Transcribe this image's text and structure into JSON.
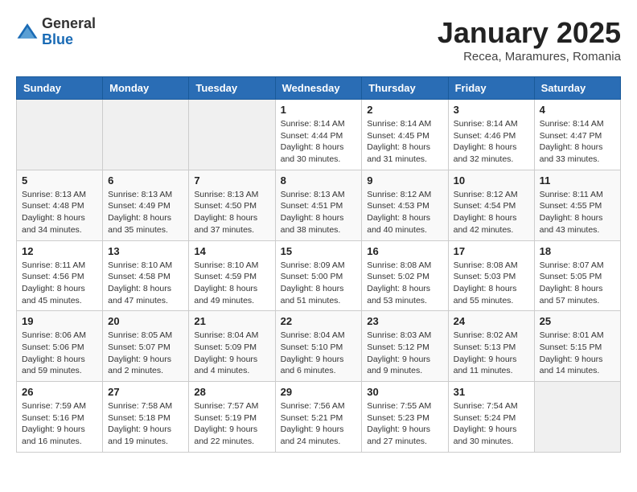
{
  "logo": {
    "general": "General",
    "blue": "Blue"
  },
  "header": {
    "title": "January 2025",
    "subtitle": "Recea, Maramures, Romania"
  },
  "weekdays": [
    "Sunday",
    "Monday",
    "Tuesday",
    "Wednesday",
    "Thursday",
    "Friday",
    "Saturday"
  ],
  "weeks": [
    [
      {
        "day": "",
        "info": ""
      },
      {
        "day": "",
        "info": ""
      },
      {
        "day": "",
        "info": ""
      },
      {
        "day": "1",
        "info": "Sunrise: 8:14 AM\nSunset: 4:44 PM\nDaylight: 8 hours\nand 30 minutes."
      },
      {
        "day": "2",
        "info": "Sunrise: 8:14 AM\nSunset: 4:45 PM\nDaylight: 8 hours\nand 31 minutes."
      },
      {
        "day": "3",
        "info": "Sunrise: 8:14 AM\nSunset: 4:46 PM\nDaylight: 8 hours\nand 32 minutes."
      },
      {
        "day": "4",
        "info": "Sunrise: 8:14 AM\nSunset: 4:47 PM\nDaylight: 8 hours\nand 33 minutes."
      }
    ],
    [
      {
        "day": "5",
        "info": "Sunrise: 8:13 AM\nSunset: 4:48 PM\nDaylight: 8 hours\nand 34 minutes."
      },
      {
        "day": "6",
        "info": "Sunrise: 8:13 AM\nSunset: 4:49 PM\nDaylight: 8 hours\nand 35 minutes."
      },
      {
        "day": "7",
        "info": "Sunrise: 8:13 AM\nSunset: 4:50 PM\nDaylight: 8 hours\nand 37 minutes."
      },
      {
        "day": "8",
        "info": "Sunrise: 8:13 AM\nSunset: 4:51 PM\nDaylight: 8 hours\nand 38 minutes."
      },
      {
        "day": "9",
        "info": "Sunrise: 8:12 AM\nSunset: 4:53 PM\nDaylight: 8 hours\nand 40 minutes."
      },
      {
        "day": "10",
        "info": "Sunrise: 8:12 AM\nSunset: 4:54 PM\nDaylight: 8 hours\nand 42 minutes."
      },
      {
        "day": "11",
        "info": "Sunrise: 8:11 AM\nSunset: 4:55 PM\nDaylight: 8 hours\nand 43 minutes."
      }
    ],
    [
      {
        "day": "12",
        "info": "Sunrise: 8:11 AM\nSunset: 4:56 PM\nDaylight: 8 hours\nand 45 minutes."
      },
      {
        "day": "13",
        "info": "Sunrise: 8:10 AM\nSunset: 4:58 PM\nDaylight: 8 hours\nand 47 minutes."
      },
      {
        "day": "14",
        "info": "Sunrise: 8:10 AM\nSunset: 4:59 PM\nDaylight: 8 hours\nand 49 minutes."
      },
      {
        "day": "15",
        "info": "Sunrise: 8:09 AM\nSunset: 5:00 PM\nDaylight: 8 hours\nand 51 minutes."
      },
      {
        "day": "16",
        "info": "Sunrise: 8:08 AM\nSunset: 5:02 PM\nDaylight: 8 hours\nand 53 minutes."
      },
      {
        "day": "17",
        "info": "Sunrise: 8:08 AM\nSunset: 5:03 PM\nDaylight: 8 hours\nand 55 minutes."
      },
      {
        "day": "18",
        "info": "Sunrise: 8:07 AM\nSunset: 5:05 PM\nDaylight: 8 hours\nand 57 minutes."
      }
    ],
    [
      {
        "day": "19",
        "info": "Sunrise: 8:06 AM\nSunset: 5:06 PM\nDaylight: 8 hours\nand 59 minutes."
      },
      {
        "day": "20",
        "info": "Sunrise: 8:05 AM\nSunset: 5:07 PM\nDaylight: 9 hours\nand 2 minutes."
      },
      {
        "day": "21",
        "info": "Sunrise: 8:04 AM\nSunset: 5:09 PM\nDaylight: 9 hours\nand 4 minutes."
      },
      {
        "day": "22",
        "info": "Sunrise: 8:04 AM\nSunset: 5:10 PM\nDaylight: 9 hours\nand 6 minutes."
      },
      {
        "day": "23",
        "info": "Sunrise: 8:03 AM\nSunset: 5:12 PM\nDaylight: 9 hours\nand 9 minutes."
      },
      {
        "day": "24",
        "info": "Sunrise: 8:02 AM\nSunset: 5:13 PM\nDaylight: 9 hours\nand 11 minutes."
      },
      {
        "day": "25",
        "info": "Sunrise: 8:01 AM\nSunset: 5:15 PM\nDaylight: 9 hours\nand 14 minutes."
      }
    ],
    [
      {
        "day": "26",
        "info": "Sunrise: 7:59 AM\nSunset: 5:16 PM\nDaylight: 9 hours\nand 16 minutes."
      },
      {
        "day": "27",
        "info": "Sunrise: 7:58 AM\nSunset: 5:18 PM\nDaylight: 9 hours\nand 19 minutes."
      },
      {
        "day": "28",
        "info": "Sunrise: 7:57 AM\nSunset: 5:19 PM\nDaylight: 9 hours\nand 22 minutes."
      },
      {
        "day": "29",
        "info": "Sunrise: 7:56 AM\nSunset: 5:21 PM\nDaylight: 9 hours\nand 24 minutes."
      },
      {
        "day": "30",
        "info": "Sunrise: 7:55 AM\nSunset: 5:23 PM\nDaylight: 9 hours\nand 27 minutes."
      },
      {
        "day": "31",
        "info": "Sunrise: 7:54 AM\nSunset: 5:24 PM\nDaylight: 9 hours\nand 30 minutes."
      },
      {
        "day": "",
        "info": ""
      }
    ]
  ]
}
